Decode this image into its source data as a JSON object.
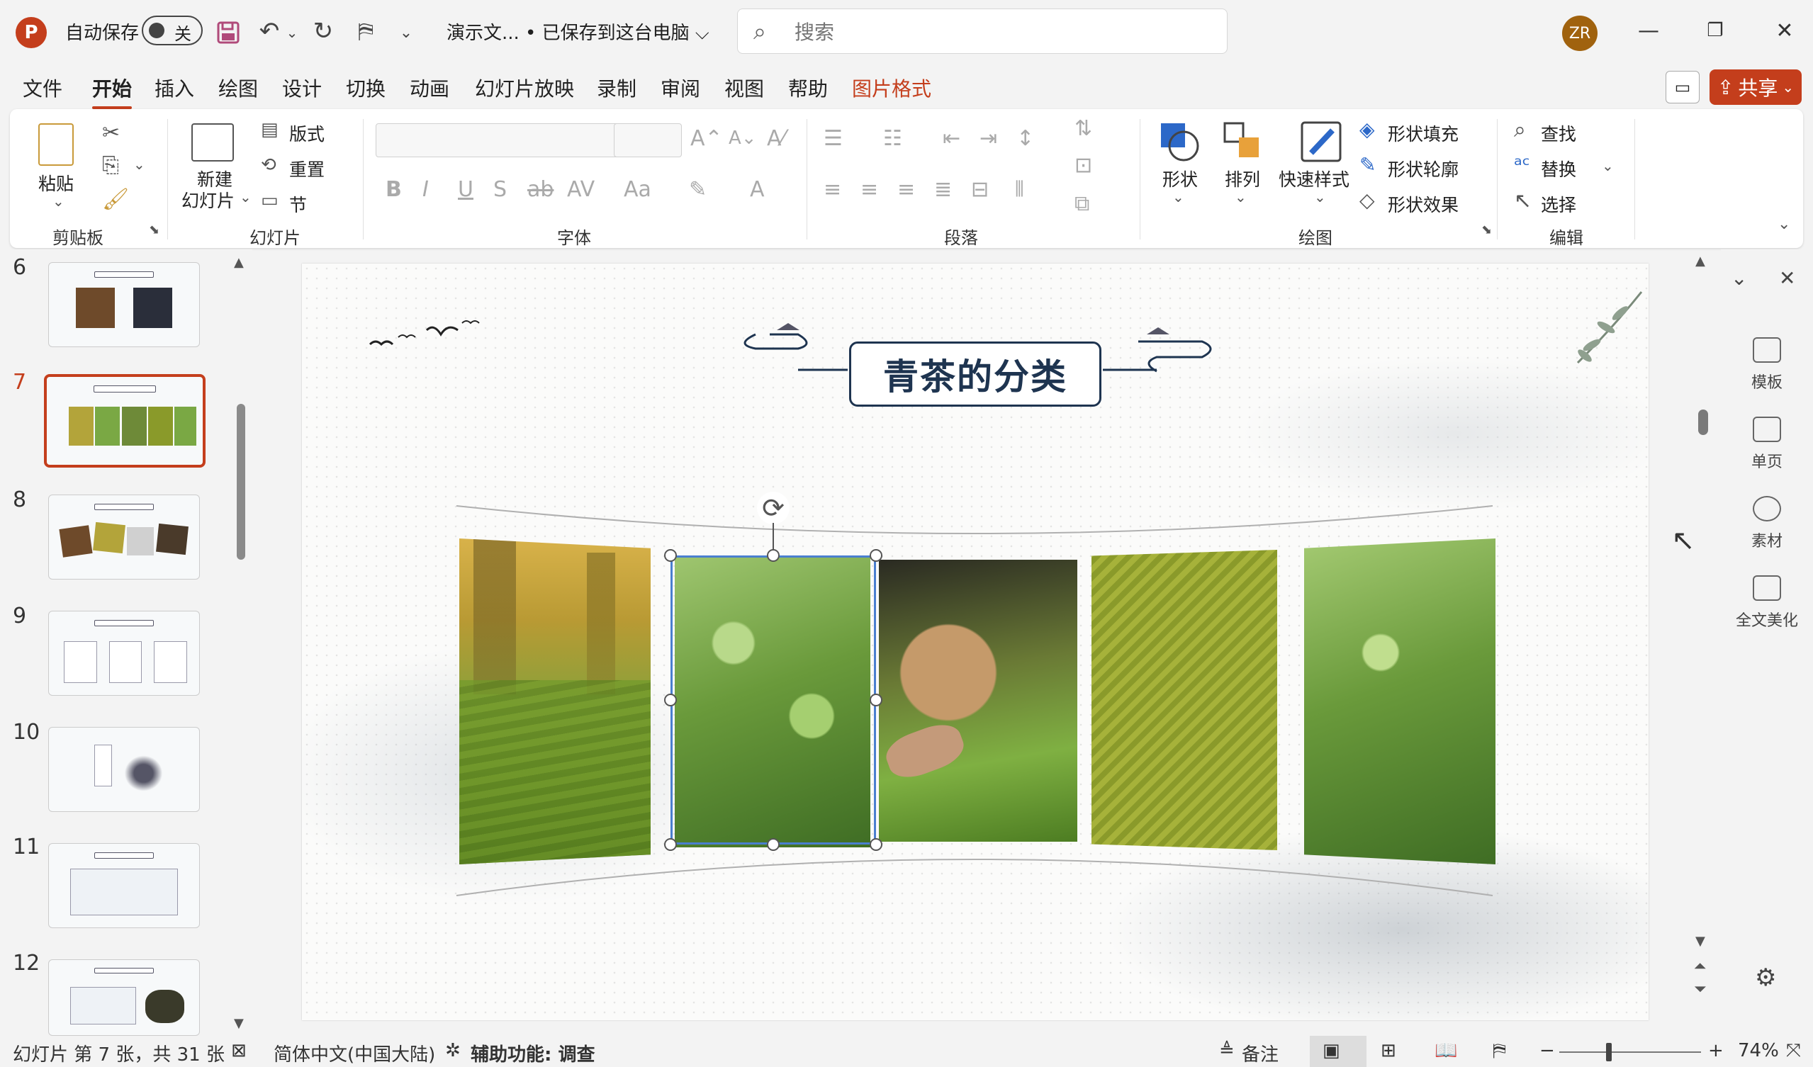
{
  "titlebar": {
    "autosave_label": "自动保存",
    "autosave_state": "关",
    "doc_title": "演示文... • 已保存到这台电脑 ⌵",
    "search_placeholder": "搜索",
    "avatar_initials": "ZR"
  },
  "menu": {
    "tabs": [
      "文件",
      "开始",
      "插入",
      "绘图",
      "设计",
      "切换",
      "动画",
      "幻灯片放映",
      "录制",
      "审阅",
      "视图",
      "帮助",
      "图片格式"
    ],
    "active": "开始",
    "share_label": "共享"
  },
  "ribbon": {
    "clipboard": {
      "paste": "粘贴",
      "label": "剪贴板"
    },
    "slides": {
      "new_slide_line1": "新建",
      "new_slide_line2": "幻灯片",
      "layout": "版式",
      "reset": "重置",
      "section": "节",
      "label": "幻灯片"
    },
    "font": {
      "label": "字体"
    },
    "paragraph": {
      "label": "段落"
    },
    "drawing": {
      "shapes": "形状",
      "arrange": "排列",
      "quick_styles": "快速样式",
      "fill": "形状填充",
      "outline": "形状轮廓",
      "effects": "形状效果",
      "label": "绘图"
    },
    "editing": {
      "find": "查找",
      "replace": "替换",
      "select": "选择",
      "label": "编辑"
    }
  },
  "thumbnails": {
    "items": [
      {
        "num": "6"
      },
      {
        "num": "7"
      },
      {
        "num": "8"
      },
      {
        "num": "9"
      },
      {
        "num": "10"
      },
      {
        "num": "11"
      },
      {
        "num": "12"
      }
    ],
    "active_num": "7"
  },
  "slide": {
    "title": "青茶的分类"
  },
  "side_pane": {
    "items": [
      "模板",
      "单页",
      "素材",
      "全文美化"
    ]
  },
  "statusbar": {
    "slide_info": "幻灯片 第 7 张，共 31 张",
    "language": "简体中文(中国大陆)",
    "accessibility": "辅助功能: 调查",
    "notes": "备注",
    "zoom": "74%"
  },
  "colors": {
    "accent": "#c43e1c",
    "title_navy": "#1e3450",
    "selection_blue": "#4a7fcf"
  }
}
